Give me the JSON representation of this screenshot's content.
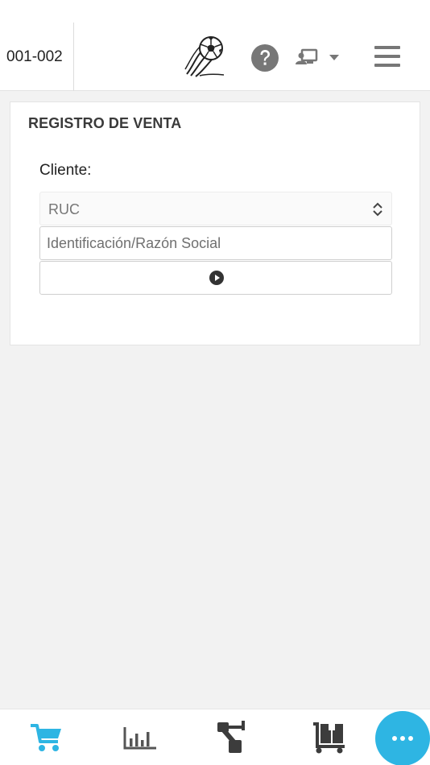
{
  "header": {
    "series": "001-002",
    "icons": {
      "logo": "soccer-ball-logo-icon",
      "help": "question-circle-icon",
      "user_switch": "user-presentation-icon",
      "menu": "hamburger-menu-icon"
    }
  },
  "form": {
    "title": "REGISTRO DE VENTA",
    "cliente_label": "Cliente:",
    "doc_type": {
      "selected": "RUC"
    },
    "identificacion": {
      "placeholder": "Identificación/Razón Social",
      "value": ""
    },
    "submit_icon": "play-circle-icon"
  },
  "bottom_nav": {
    "items": [
      {
        "icon": "shopping-cart-icon",
        "active": true
      },
      {
        "icon": "bar-chart-icon",
        "active": false
      },
      {
        "icon": "hierarchy-icon",
        "active": false
      },
      {
        "icon": "dolly-boxes-icon",
        "active": false
      }
    ],
    "fab_icon": "ellipsis-icon"
  },
  "colors": {
    "accent": "#2eb5e3",
    "icon_gray": "#666666",
    "dark_icon": "#3c3c3c",
    "background": "#f2f2f2"
  }
}
